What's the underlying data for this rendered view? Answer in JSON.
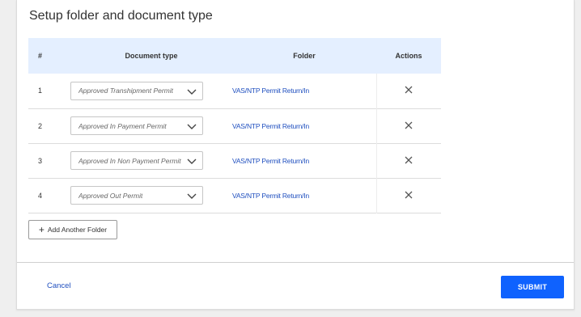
{
  "page": {
    "title": "Setup folder and document type"
  },
  "table": {
    "headers": {
      "num": "#",
      "document_type": "Document type",
      "folder": "Folder",
      "actions": "Actions"
    },
    "rows": [
      {
        "num": "1",
        "document_type": "Approved Transhipment Permit",
        "folder": "VAS/NTP Permit Return/In"
      },
      {
        "num": "2",
        "document_type": "Approved In Payment Permit",
        "folder": "VAS/NTP Permit Return/In"
      },
      {
        "num": "3",
        "document_type": "Approved In Non Payment Permit",
        "folder": "VAS/NTP Permit Return/In"
      },
      {
        "num": "4",
        "document_type": "Approved Out Permit",
        "folder": "VAS/NTP Permit Return/In"
      }
    ]
  },
  "actions": {
    "add_folder_label": "Add Another Folder",
    "cancel_label": "Cancel",
    "submit_label": "SUBMIT"
  },
  "colors": {
    "header_bg": "#e4efff",
    "link": "#1f4fbf",
    "primary": "#0f62fe"
  },
  "icons": {
    "dropdown": "chevron-down-icon",
    "remove": "close-icon",
    "add": "plus-icon"
  }
}
